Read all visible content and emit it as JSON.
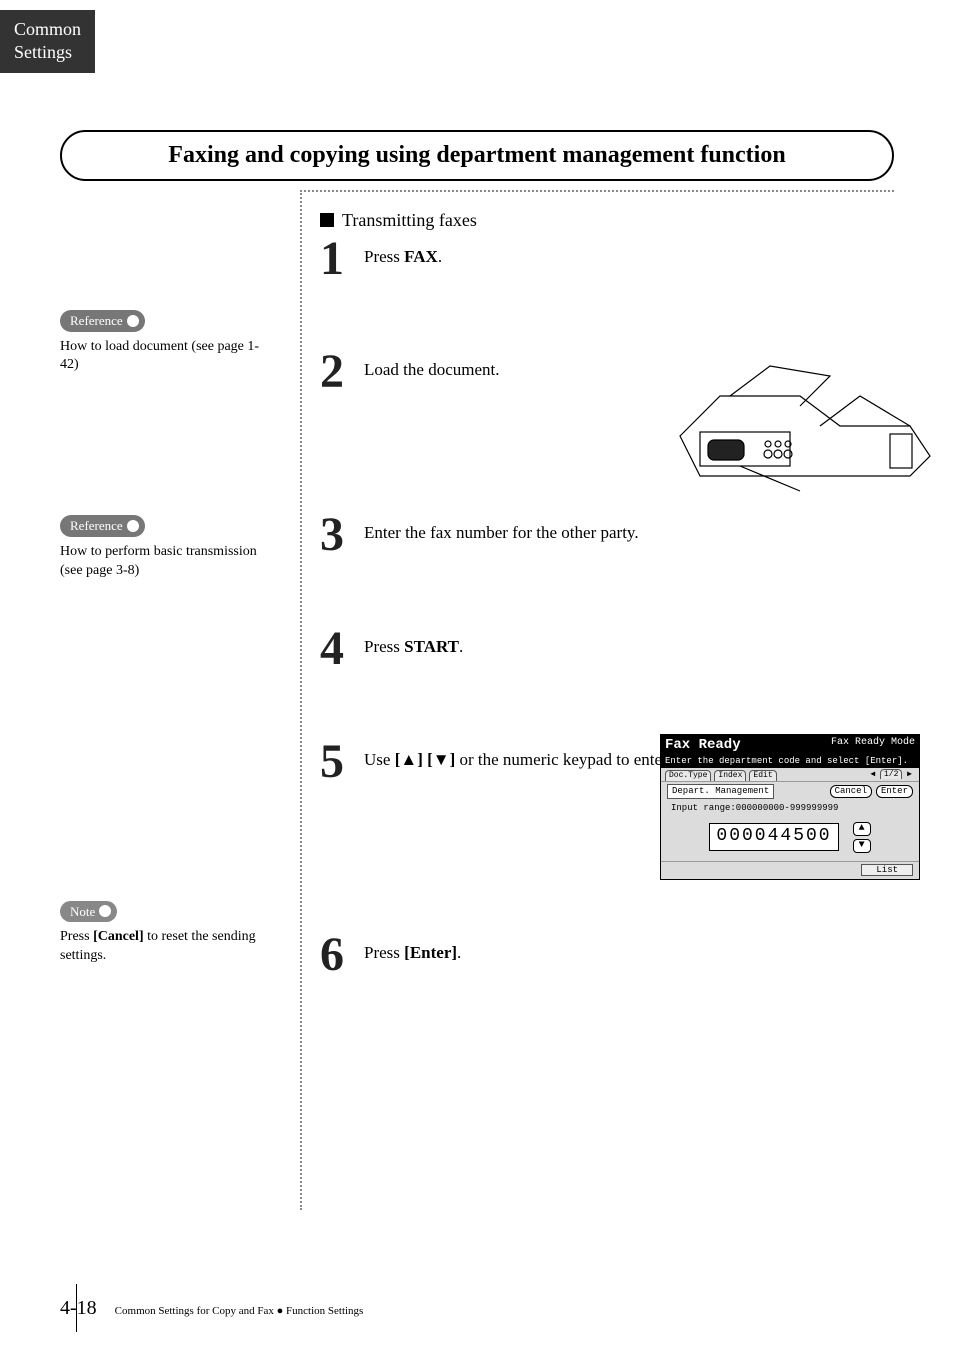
{
  "thumb_tab": {
    "line1": "Common",
    "line2": "Settings"
  },
  "title": "Faxing and copying using department management function",
  "section_heading": "Transmitting faxes",
  "steps": [
    {
      "num": "1",
      "pre": "Press ",
      "bold": "FAX",
      "post": "."
    },
    {
      "num": "2",
      "pre": "Load the document.",
      "bold": "",
      "post": ""
    },
    {
      "num": "3",
      "pre": "Enter the fax number for the other party.",
      "bold": "",
      "post": ""
    },
    {
      "num": "4",
      "pre": "Press ",
      "bold": "START",
      "post": "."
    },
    {
      "num": "5",
      "pre": "Use ",
      "bold": "[▲] [▼]",
      "post": " or the numeric keypad to enter."
    },
    {
      "num": "6",
      "pre": "Press ",
      "bold": "[Enter]",
      "post": "."
    }
  ],
  "notes": {
    "ref1": {
      "badge": "Reference",
      "body": "How to load document (see page 1-42)"
    },
    "ref2": {
      "badge": "Reference",
      "body": "How to perform basic transmission (see page 3-8)"
    },
    "note1": {
      "badge": "Note",
      "body_pre": "Press ",
      "body_bold": "[Cancel]",
      "body_post": " to reset the sending settings."
    }
  },
  "lcd": {
    "ready": "Fax Ready",
    "mode": "Fax Ready Mode",
    "prompt": "Enter the department code and select [Enter].",
    "tabs": [
      "Doc.Type",
      "Index",
      "Edit"
    ],
    "page": "1/2",
    "field_label": "Depart. Management",
    "cancel": "Cancel",
    "enter": "Enter",
    "range": "Input range:000000000-999999999",
    "value": "000044500",
    "list": "List"
  },
  "footer": {
    "page_num": "4-18",
    "breadcrumb_a": "Common Settings for Copy and Fax",
    "breadcrumb_b": "Function Settings"
  }
}
